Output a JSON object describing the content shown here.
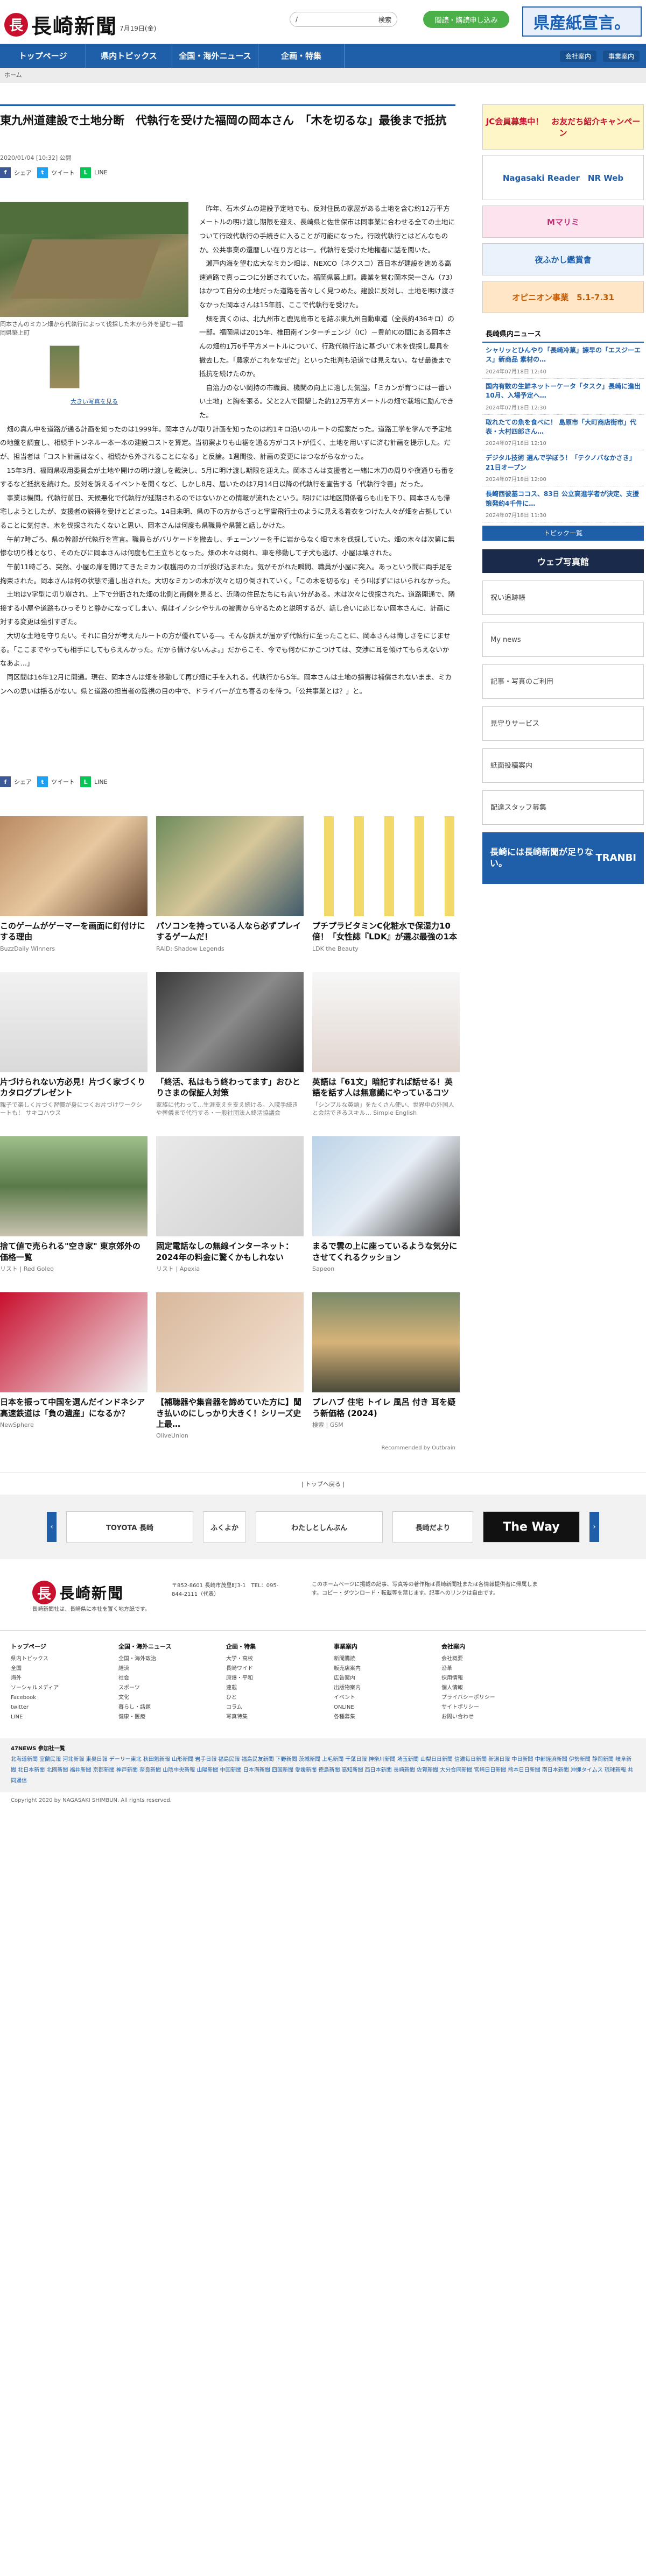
{
  "header": {
    "logo_mark": "長",
    "logo_text": "長崎新聞",
    "date": "7月19日(金)",
    "search_placeholder": "",
    "search_separator": "/",
    "search_button": "検索",
    "subscribe_button": "閲読・購読申し込み",
    "promo_text": "県産紙宣言。"
  },
  "nav": {
    "items": [
      "トップページ",
      "県内トピックス",
      "全国・海外ニュース",
      "企画・特集"
    ],
    "small_left": "会社案内",
    "small_right": "事業案内"
  },
  "breadcrumb": "ホーム",
  "article": {
    "title": "東九州道建設で土地分断　代執行を受けた福岡の岡本さん　「木を切るな」最後まで抵抗",
    "meta_date": "2020/01/04 [10:32]",
    "meta_label": "公開",
    "share_labels": [
      "シェア",
      "ツイート",
      "LINE"
    ],
    "photo_caption": "岡本さんのミカン畑から代執行によって伐採した木から外を望む＝福岡県築上町",
    "photo_link": "大きい写真を見る",
    "paragraphs": [
      "昨年、石木ダムの建設予定地でも、反対住民の家屋がある土地を含む約12万平方メートルの明け渡し期限を迎え、長崎県と佐世保市は同事業に合わせる全ての土地について行政代執行の手続きに入ることが可能になった。行政代執行とはどんなものか。公共事業の還暦しい在り方とは一。代執行を受けた地権者に話を聞いた。",
      "瀬戸内海を望む広大なミカン畑は、NEXCO（ネクスコ）西日本が建設を進める高速道路で真っ二つに分断されていた。福岡県築上町。農業を営む岡本栄一さん（73）はかつて自分の土地だった道路を苦々しく見つめた。建設に反対し、土地を明け渡さなかった岡本さんは15年前、ここで代執行を受けた。",
      "畑を貫くのは、北九州市と鹿児島市とを結ぶ東九州自動車道（全長約436キロ）の一部。福岡県は2015年、椎田南インターチェンジ（IC）－豊前ICの間にある岡本さんの畑約1万6千平方メートルについて、行政代執行法に基づいて木を伐採し農具を撤去した。「農家がこれをなぜだ」といった批判も沿道では見えない。なぜ最後まで抵抗を続けたのか。",
      "自治力のない岡持の市職員、機関の向上に適した気温。「ミカンが育つには一番いい土地」と胸を張る。父と2人で開墾した約12万平方メートルの畑で栽培に励んできた。",
      "畑の真ん中を道路が通る計画を知ったのは1999年。岡本さんが取り計画を知ったのは約1キロ沿いのルートの提案だった。道路工学を学んで予定地の地盤を調査し、相続手トンネル一本一本の建設コストを算定。当初案よりも山裾を通る方がコストが低く、土地を用いずに済む計画を提示した。だが、担当者は「コスト計画はなく、相続から外されることになる」と反論。1週間後、計画の変更にはつながらなかった。",
      "15年3月、福岡県収用委員会が土地や開けの明け渡しを裁決し、5月に明け渡し期限を迎えた。岡本さんは支援者と一緒に木刀の周りや夜通りも番をするなど抵抗を続けた。反対を訴えるイベントを開くなど、しかし8月、届いたのは7月14日以降の代執行を宣告する「代執行令書」だった。",
      "事業は機関。代執行前日、天候悪化で代執行が延期されるのではないかとの情報が流れたという。明けには地区関係者らも山を下り、岡本さんも帰宅しようとしたが、支援者の説得を受けとどまった。14日未明、県の下の方からざっと宇宙飛行士のように見える着衣をつけた人々が畑を占拠していることに気付き、木を伐採されたくないと思い、岡本さんは何度も県職員や県警と話しかけた。",
      "午前7時ごろ、県の幹部が代執行を宣言。職員らがバリケードを撤去し、チェーンソーを手に岩からなく畑で木を伐採していた。畑の木々は次第に無惨な切り株となり、そのたびに岡本さんは何度も仁王立ちとなった。畑の木々は倒れ、車を移動して子犬も逃げ、小屋は壊された。",
      "午前11時ごろ、突然、小屋の扉を開けてきたミカン収穫用のカゴが投げ込まれた。気がそがれた瞬間、職員が小屋に突入。あっという間に両手足を拘束された。岡本さんは何の状態で通し出された。大切なミカンの木が次々と切り倒されていく。「この木を切るな」そう叫ばずにはいられなかった。",
      "土地はV字型に切り崩され、上下で分断された畑の北側と南側を見ると、近隣の住民たちにも言い分がある。木は次々に伐採された。道路開通で、隣接する小屋や道路もひっそりと静かになってしまい、県はイノシシやサルの被害から守るためと説明するが、話し合いに応じない岡本さんに、計画に対する変更は強引すぎた。",
      "大切な土地を守りたい。それに自分が考えたルートの方が優れている―。そんな訴えが届かず代執行に至ったことに、岡本さんは悔しさをにじませる。「ここまでやっても相手にしてもらえんかった。だから情けないんよ。」だからこそ、今でも何かにかこつけては、交渉に耳を傾けてもらえないかなあよ…」",
      "同区間は16年12月に開通。現在、岡本さんは畑を移動して再び畑に手を入れる。代執行から5年。岡本さんは土地の損害は補償されないまま、ミカンへの思いは揺るがない。県と道路の担当者の監視の目の中で、ドライバーが立ち寄るのを待つ。「公共事業とは？」と。"
    ]
  },
  "sponsored": [
    {
      "title": "このゲームがゲーマーを画面に釘付けにする理由",
      "source": "BuzzDaily Winners"
    },
    {
      "title": "パソコンを持っている人なら必ずプレイするゲームだ！",
      "source": "RAID: Shadow Legends"
    },
    {
      "title": "プチプラビタミンC化粧水で保湿力10倍！「女性誌『LDK』が選ぶ最強の1本",
      "source": "LDK the Beauty"
    },
    {
      "title": "片づけられない方必見！片づく家づくりカタログプレゼント",
      "source": "親子で楽しく片づく習慣が身につくお片づけワークシートも！ サキコハウス"
    },
    {
      "title": "「終活、私はもう終わってます」おひとりさまの保証人対策",
      "source": "家族に代わって…生涯支えを支え続ける。入院手続きや葬儀まで代行する・一般社団法人終活協議会"
    },
    {
      "title": "英語は「61文」暗記すれば話せる！英語を話す人は無意識にやっているコツ",
      "source": "「シンプルな英語」をたくさん使い、世界中の外国人と会話できるスキル… Simple English"
    },
    {
      "title": "捨て値で売られる\"空き家\" 東京郊外の価格一覧",
      "source": "リスト | Red Goleo"
    },
    {
      "title": "固定電話なしの無線インターネット：2024年の料金に驚くかもしれない",
      "source": "リスト | Apexia"
    },
    {
      "title": "まるで雲の上に座っているような気分にさせてくれるクッション",
      "source": "Sapeon"
    },
    {
      "title": "日本を振って中国を選んだインドネシア高速鉄道は「負の遺産」になるか？",
      "source": "NewSphere"
    },
    {
      "title": "【補聴器や集音器を諦めていた方に】聞き払いのにしっかり大きく！シリーズ史上最…",
      "source": "OliveUnion"
    },
    {
      "title": "プレハブ 住宅 トイレ 風呂 付き 耳を疑う新価格 (2024)",
      "source": "検索 | GSM"
    }
  ],
  "outbrain_credit": "Recommended by Outbrain",
  "sidebar": {
    "banners": [
      "JC会員募集中！　お友だち紹介キャンペーン",
      "Nagasaki Reader　NR Web",
      "Mマリミ",
      "夜ふかし鑑賞會",
      "オピニオン事業　5.1-7.31"
    ],
    "section_title": "長崎県内ニュース",
    "news": [
      {
        "title": "シャリッとひんやり「長崎冷菓」諫早の「エスジーエス」新商品 素材の…",
        "date": "2024年07月18日 12:40"
      },
      {
        "title": "国内有数の生鮮ネットーケータ「タスク」長崎に進出 10月、入場予定へ…",
        "date": "2024年07月18日 12:30"
      },
      {
        "title": "取れたての魚を食べに！ 島原市「大町商店街市」代表・大村四郎さん…",
        "date": "2024年07月18日 12:10"
      },
      {
        "title": "デジタル技術 選んで学ぼう！「テクノバなかさき」21日オープン",
        "date": "2024年07月18日 12:00"
      },
      {
        "title": "長崎西彼基ココス、83日 公立高進学者が決定、支援策発約4千件に…",
        "date": "2024年07月18日 11:30"
      }
    ],
    "more_button": "トピック一覧",
    "webstore": "ウェブ写真館",
    "boxes": [
      "祝い追跡帳",
      "My news",
      "記事・写真のご利用",
      "見守りサービス",
      "紙面投稿案内",
      "配達スタッフ募集"
    ],
    "newspaper_banner_left": "長崎には長崎新聞が足りない。",
    "newspaper_banner_right": "TRANBI"
  },
  "backtop": "| トップへ戻る |",
  "carousel": [
    "TOYOTA 長崎",
    "ふくよか",
    "わたしとしんぶん",
    "長崎だより",
    "The Way"
  ],
  "footer": {
    "address": "〒852-8601 長崎市茂里町3-1　TEL：095-844-2111（代表）",
    "address_note": "長崎新聞社は、長崎県に本社を置く地方紙です。",
    "note": "このホームページに掲載の記事、写真等の著作権は長崎新聞社または各情報提供者に帰属します。コピー・ダウンロード・転載等を禁じます。記事へのリンクは自由です。",
    "cols": [
      {
        "h": "トップページ",
        "items": [
          "県内トピックス",
          "全国",
          "海外",
          "ソーシャルメディア",
          "Facebook",
          "twitter",
          "LINE"
        ]
      },
      {
        "h": "全国・海外ニュース",
        "items": [
          "全国・海外政治",
          "経済",
          "社会",
          "スポーツ",
          "文化",
          "暮らし・話題",
          "健康・医療"
        ]
      },
      {
        "h": "企画・特集",
        "items": [
          "大学・高校",
          "長崎ワイド",
          "原爆・平和",
          "連載",
          "ひと",
          "コラム",
          "写真特集"
        ]
      },
      {
        "h": "事業案内",
        "items": [
          "新聞購読",
          "販売店案内",
          "広告案内",
          "出版物案内",
          "イベント",
          "ONLINE",
          "各種募集"
        ]
      },
      {
        "h": "会社案内",
        "items": [
          "会社概要",
          "沿革",
          "採用情報",
          "個人情報",
          "プライバシーポリシー",
          "サイトポリシー",
          "お問い合わせ"
        ]
      }
    ],
    "press_title": "47NEWS 参加社一覧",
    "press_list": "北海道新聞 室蘭民報 河北新報 東奥日報 デーリー東北 秋田魁新報 山形新聞 岩手日報 福島民報 福島民友新聞 下野新聞 茨城新聞 上毛新聞 千葉日報 神奈川新聞 埼玉新聞 山梨日日新聞 信濃毎日新聞 新潟日報 中日新聞 中部経済新聞 伊勢新聞 静岡新聞 岐阜新聞 北日本新聞 北國新聞 福井新聞 京都新聞 神戸新聞 奈良新聞 山陰中央新報 山陽新聞 中国新聞 日本海新聞 四国新聞 愛媛新聞 徳島新聞 高知新聞 西日本新聞 長崎新聞 佐賀新聞 大分合同新聞 宮崎日日新聞 熊本日日新聞 南日本新聞 沖縄タイムス 琉球新報 共同通信",
    "copyright": "Copyright 2020 by NAGASAKI SHIMBUN. All rights reserved."
  },
  "colors": {
    "brand": "#1f5ea8",
    "logo_red": "#c8102e",
    "green": "#4cb04a"
  }
}
